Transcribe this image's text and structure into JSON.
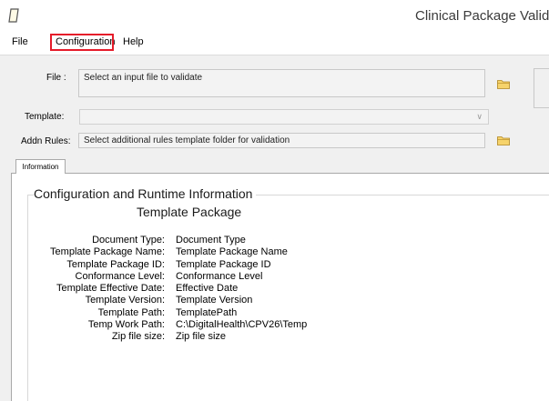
{
  "window": {
    "title": "Clinical Package Validator"
  },
  "menu": {
    "file": "File",
    "configuration": "Configuration",
    "help": "Help"
  },
  "form": {
    "file_label": "File :",
    "file_placeholder": "Select an input file to validate",
    "template_label": "Template:",
    "template_value": "",
    "addn_rules_label": "Addn Rules:",
    "addn_rules_placeholder": "Select additional rules template folder for validation"
  },
  "tabs": [
    {
      "label": "Information"
    }
  ],
  "info": {
    "group_title": "Configuration and Runtime Information",
    "section_title": "Template Package",
    "rows": [
      {
        "key": "Document Type:",
        "value": "Document Type"
      },
      {
        "key": "Template Package Name:",
        "value": "Template Package Name"
      },
      {
        "key": "Template Package ID:",
        "value": "Template Package ID"
      },
      {
        "key": "Conformance Level:",
        "value": "Conformance Level"
      },
      {
        "key": "Template Effective Date:",
        "value": "Effective Date"
      },
      {
        "key": "Template Version:",
        "value": "Template Version"
      },
      {
        "key": "Template Path:",
        "value": "TemplatePath"
      },
      {
        "key": "Temp Work Path:",
        "value": "C:\\DigitalHealth\\CPV26\\Temp"
      },
      {
        "key": "Zip file size:",
        "value": "Zip file size"
      }
    ]
  },
  "colors": {
    "highlight": "#e51b2a",
    "folder": "#e7b93a"
  }
}
